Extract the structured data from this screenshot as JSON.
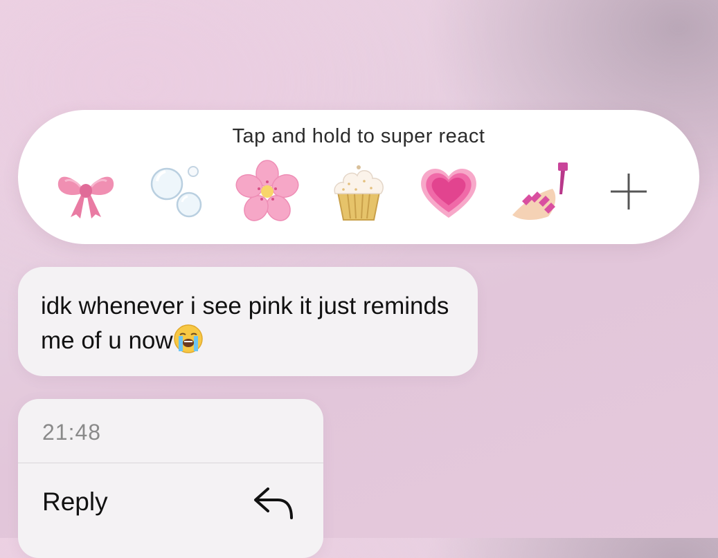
{
  "reaction_bar": {
    "hint": "Tap and hold to super react",
    "emojis": [
      {
        "icon": "ribbon-bow-icon",
        "glyph": "🎀"
      },
      {
        "icon": "bubbles-icon",
        "glyph": "🫧"
      },
      {
        "icon": "cherry-blossom-icon",
        "glyph": "🌸"
      },
      {
        "icon": "cupcake-icon",
        "glyph": "🧁"
      },
      {
        "icon": "growing-heart-icon",
        "glyph": "💗"
      },
      {
        "icon": "nail-polish-icon",
        "glyph": "💅"
      },
      {
        "icon": "plus-icon",
        "glyph": "+"
      }
    ]
  },
  "message": {
    "text": "idk whenever i see pink it just reminds me of u now",
    "trailing_emoji": "loudly-crying-face-icon"
  },
  "context_menu": {
    "time": "21:48",
    "reply_label": "Reply",
    "reply_icon": "reply-arrow-icon"
  },
  "colors": {
    "background": "#e8cfe0",
    "bubble": "#f4f2f4",
    "card": "#ffffff",
    "muted_text": "#8a8a8a",
    "pink_accent": "#f06aa8"
  }
}
